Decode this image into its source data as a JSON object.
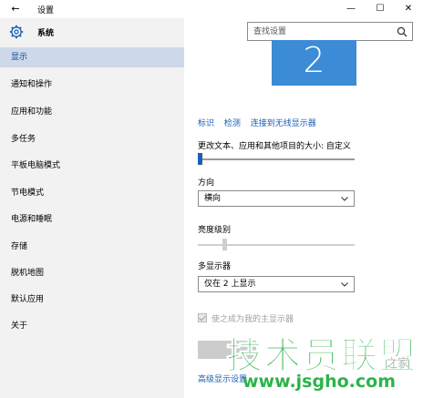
{
  "window": {
    "title": "设置",
    "back_glyph": "←",
    "minimize_glyph": "—",
    "maximize_glyph": "☐",
    "close_glyph": "✕"
  },
  "sidebar": {
    "header_label": "系统",
    "items": [
      {
        "label": "显示",
        "active": true
      },
      {
        "label": "通知和操作"
      },
      {
        "label": "应用和功能"
      },
      {
        "label": "多任务"
      },
      {
        "label": "平板电脑模式"
      },
      {
        "label": "节电模式"
      },
      {
        "label": "电源和睡眠"
      },
      {
        "label": "存储"
      },
      {
        "label": "脱机地图"
      },
      {
        "label": "默认应用"
      },
      {
        "label": "关于"
      }
    ]
  },
  "search": {
    "placeholder": "查找设置"
  },
  "main": {
    "monitor_number": "2",
    "links": {
      "identify": "标识",
      "detect": "检测",
      "connect_wireless": "连接到无线显示器"
    },
    "scale_label": "更改文本、应用和其他项目的大小: 自定义",
    "scale_level": 0.0,
    "orientation_label": "方向",
    "orientation_value": "横向",
    "brightness_label": "亮度级别",
    "brightness_level": 0.16,
    "multi_display_label": "多显示器",
    "multi_display_value": "仅在 2 上显示",
    "primary_checkbox_label": "使之成为我的主显示器",
    "advanced_link": "高级显示设置"
  },
  "watermark": {
    "brand": "技术员联盟",
    "url": "www.jsgho.com",
    "side": "之家"
  },
  "colors": {
    "accent": "#3b8bd7",
    "active_nav": "#cdd9ea",
    "link": "#1a5fb4",
    "watermark_green": "#2db34a"
  }
}
